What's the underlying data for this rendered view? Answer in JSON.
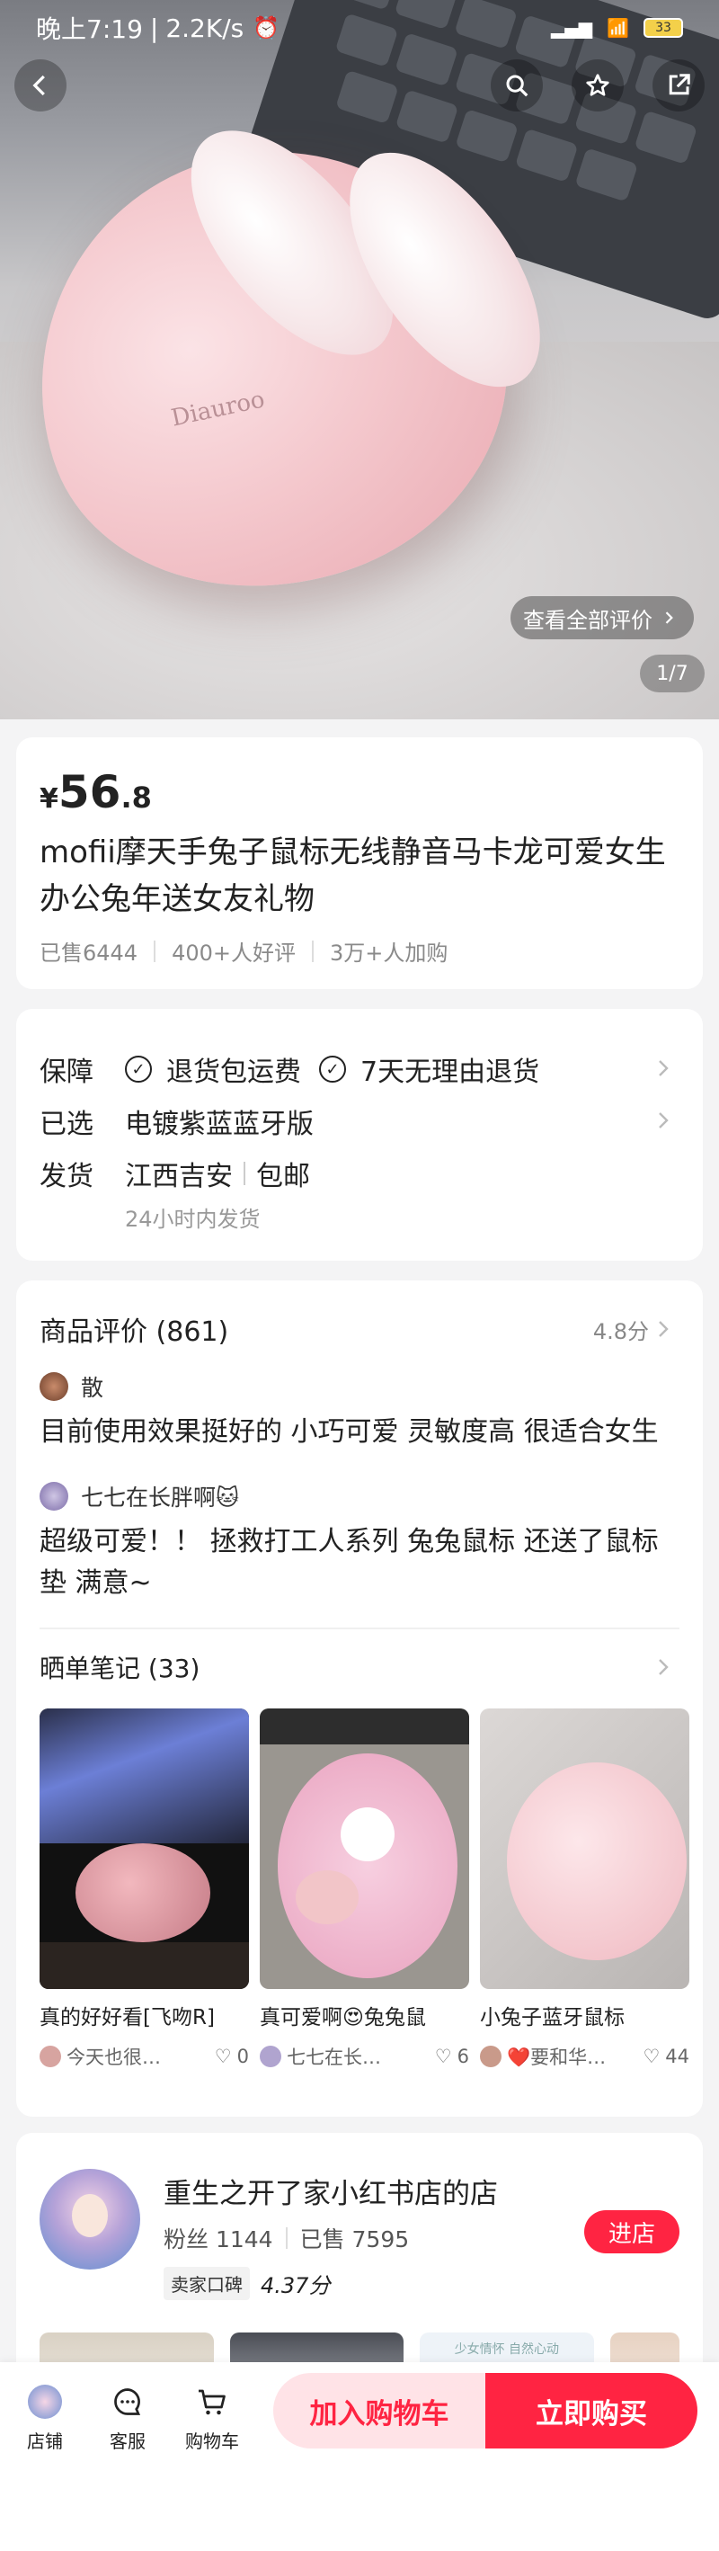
{
  "status_bar": {
    "time": "晚上7:19",
    "speed": "2.2K/s",
    "battery": "33"
  },
  "hero": {
    "review_pill": "查看全部评价",
    "counter": "1/7",
    "logo_text": "Diauroo"
  },
  "product": {
    "price_symbol": "¥",
    "price_int": "56",
    "price_dec": ".8",
    "title": "mofii摩天手兔子鼠标无线静音马卡龙可爱女生办公兔年送女友礼物",
    "sold": "已售6444",
    "good_reviews": "400+人好评",
    "cart_adds": "3万+人加购"
  },
  "service": {
    "guarantee_label": "保障",
    "guarantee_1": "退货包运费",
    "guarantee_2": "7天无理由退货",
    "selected_label": "已选",
    "selected_value": "电镀紫蓝蓝牙版",
    "ship_label": "发货",
    "ship_from": "江西吉安",
    "ship_free": "包邮",
    "ship_time": "24小时内发货"
  },
  "reviews": {
    "title": "商品评价 (861)",
    "score": "4.8分",
    "items": [
      {
        "user": "散",
        "text": "目前使用效果挺好的 小巧可爱 灵敏度高 很适合女生"
      },
      {
        "user": "七七在长胖啊🐱",
        "text": "超级可爱！！ 拯救打工人系列 兔兔鼠标 还送了鼠标垫 满意~"
      }
    ],
    "notes_title": "晒单笔记 (33)",
    "notes": [
      {
        "caption": "真的好好看[飞吻R]",
        "author": "今天也很…",
        "likes": "0"
      },
      {
        "caption": "真可爱啊😍兔兔鼠",
        "author": "七七在长…",
        "likes": "6"
      },
      {
        "caption": "小兔子蓝牙鼠标",
        "author": "❤️要和华…",
        "likes": "44"
      }
    ]
  },
  "shop": {
    "name": "重生之开了家小红书店的店",
    "fans": "粉丝 1144",
    "sold": "已售 7595",
    "rep_label": "卖家口碑",
    "rep_score": "4.37分",
    "enter": "进店",
    "img_text": "少女情怀 自然心动"
  },
  "bottom_bar": {
    "store": "店铺",
    "service": "客服",
    "cart": "购物车",
    "add_cart": "加入购物车",
    "buy_now": "立即购买"
  },
  "colors": {
    "accent": "#ff2442",
    "accent_light": "#ffe3e7"
  }
}
